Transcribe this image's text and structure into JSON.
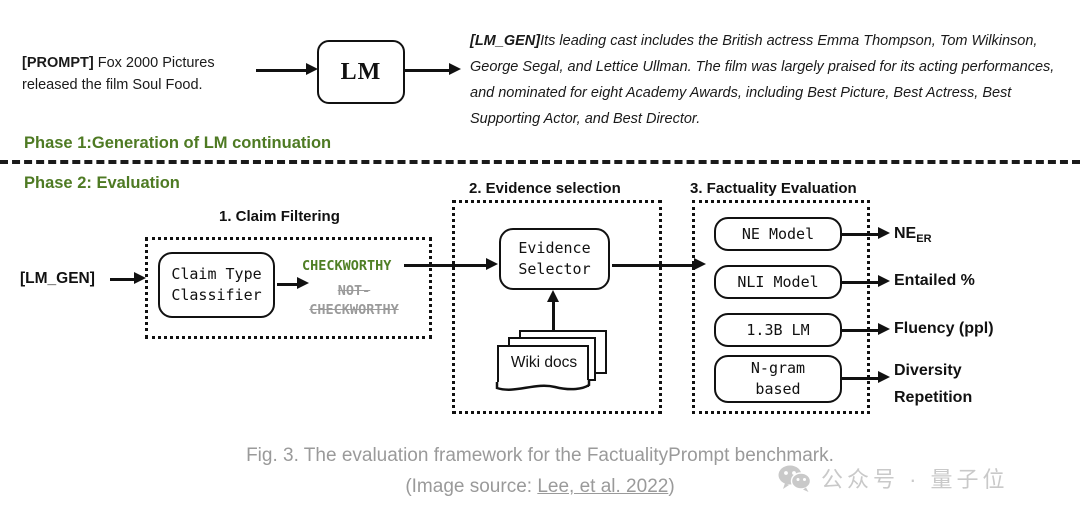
{
  "phase1": {
    "label": "Phase 1:Generation of LM continuation",
    "prompt_tag": "[PROMPT]",
    "prompt_text": " Fox 2000 Pictures released the film Soul Food.",
    "lm_box_label": "LM",
    "gen_tag": "[LM_GEN]",
    "gen_text": "Its leading cast includes the British actress Emma Thompson, Tom Wilkinson, George Segal, and Lettice Ullman. The film was largely praised for its acting performances, and nominated for eight Academy Awards, including Best Picture, Best Actress, Best Supporting Actor, and Best Director."
  },
  "phase2": {
    "label": "Phase 2: Evaluation",
    "input_label": "[LM_GEN]",
    "sections": [
      {
        "title": "1. Claim Filtering"
      },
      {
        "title": "2. Evidence selection"
      },
      {
        "title": "3. Factuality Evaluation"
      }
    ],
    "claim_filtering": {
      "box_label_line1": "Claim Type",
      "box_label_line2": "Classifier",
      "accepted_label": "CHECKWORTHY",
      "rejected_label": "NOT-CHECKWORTHY"
    },
    "evidence_selection": {
      "box_label_line1": "Evidence",
      "box_label_line2": "Selector",
      "docs_label": "Wiki docs"
    },
    "factuality_evaluation": {
      "rows": [
        {
          "model": "NE Model",
          "model_line2": "",
          "output": "NE",
          "output_sub": "ER",
          "output_line2": ""
        },
        {
          "model": "NLI Model",
          "model_line2": "",
          "output": "Entailed %",
          "output_sub": "",
          "output_line2": ""
        },
        {
          "model": "1.3B LM",
          "model_line2": "",
          "output": "Fluency (ppl)",
          "output_sub": "",
          "output_line2": ""
        },
        {
          "model": "N-gram",
          "model_line2": "based",
          "output": "Diversity",
          "output_sub": "",
          "output_line2": "Repetition"
        }
      ]
    }
  },
  "caption": {
    "line1": "Fig. 3. The evaluation framework for the FactualityPrompt benchmark.",
    "line2_prefix": "(Image source: ",
    "line2_link": "Lee, et al. 2022",
    "line2_suffix": ")"
  },
  "watermark": {
    "text": "公众号 · 量子位",
    "icon": "wechat-icon"
  },
  "colors": {
    "phase_green": "#4e7a23",
    "checkworthy_green": "#4f7f25",
    "rejected_gray": "#9b9b9b",
    "ink": "#111111",
    "caption_gray": "#9a9a9a",
    "watermark_gray": "#c9c9c9"
  }
}
